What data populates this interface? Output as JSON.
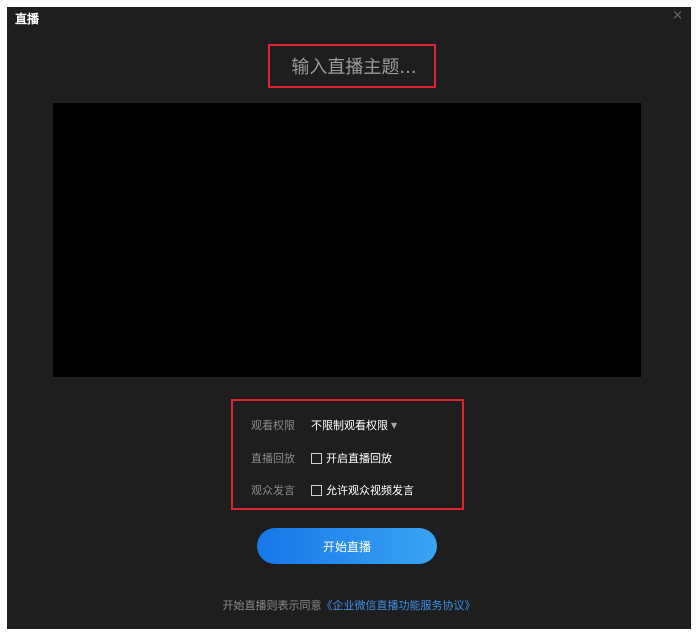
{
  "window": {
    "title": "直播",
    "close_glyph": "×"
  },
  "topic": {
    "placeholder": "输入直播主题..."
  },
  "settings": {
    "permission": {
      "label": "观看权限",
      "value": "不限制观看权限"
    },
    "replay": {
      "label": "直播回放",
      "option": "开启直播回放",
      "checked": false
    },
    "comments": {
      "label": "观众发言",
      "option": "允许观众视频发言",
      "checked": false
    }
  },
  "start_button": {
    "label": "开始直播"
  },
  "agreement": {
    "prefix": "开始直播则表示同意",
    "link": "《企业微信直播功能服务协议》"
  },
  "colors": {
    "background": "#1e1e1e",
    "highlight_border": "#e0242d",
    "button_start": "#1677e8",
    "button_end": "#3aa4f3",
    "link": "#3b8fe6"
  }
}
